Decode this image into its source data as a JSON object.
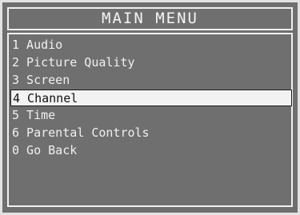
{
  "title": "MAIN MENU",
  "items": [
    {
      "label": "1 Audio",
      "selected": false
    },
    {
      "label": "2 Picture Quality",
      "selected": false
    },
    {
      "label": "3 Screen",
      "selected": false
    },
    {
      "label": "4 Channel",
      "selected": true
    },
    {
      "label": "5 Time",
      "selected": false
    },
    {
      "label": "6 Parental Controls",
      "selected": false
    },
    {
      "label": "0 Go Back",
      "selected": false
    }
  ],
  "colors": {
    "background": "#6f6f6f",
    "text": "#f0f0f0",
    "highlight": "#f2f2f2",
    "highlight_text": "#111111"
  }
}
